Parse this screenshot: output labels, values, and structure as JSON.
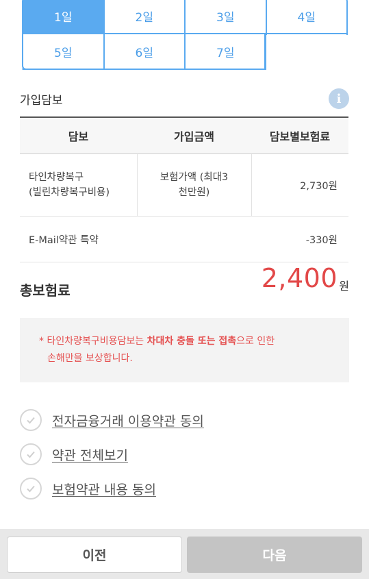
{
  "days": [
    {
      "label": "1일",
      "active": true
    },
    {
      "label": "2일",
      "active": false
    },
    {
      "label": "3일",
      "active": false
    },
    {
      "label": "4일",
      "active": false
    },
    {
      "label": "5일",
      "active": false
    },
    {
      "label": "6일",
      "active": false
    },
    {
      "label": "7일",
      "active": false
    }
  ],
  "coverage": {
    "title": "가입담보",
    "info_icon": "info-icon",
    "headers": {
      "col1": "담보",
      "col2": "가입금액",
      "col3": "담보별보험료"
    },
    "rows": [
      {
        "name_line1": "타인차량복구",
        "name_line2": "(빌린차량복구비용)",
        "amount_line1": "보험가액 (최대3",
        "amount_line2": "천만원)",
        "premium": "2,730원"
      },
      {
        "name_line1": "E-Mail약관 특약",
        "premium": "-330원"
      }
    ]
  },
  "total": {
    "label": "총보험료",
    "amount": "2,400",
    "unit": "원"
  },
  "notice": {
    "prefix": "* 타인차량복구비용담보는 ",
    "bold": "차대차 충돌 또는 접촉",
    "suffix": "으로 인한",
    "line2": "손해만을 보상합니다."
  },
  "agreements": [
    {
      "label": "전자금융거래 이용약관 동의",
      "icon": "check-icon"
    },
    {
      "label": "약관 전체보기",
      "icon": "check-icon"
    },
    {
      "label": "보험약관 내용 동의",
      "icon": "check-icon"
    }
  ],
  "buttons": {
    "prev": "이전",
    "next": "다음"
  },
  "colors": {
    "accent": "#5aaaf0",
    "highlight": "#e24848",
    "disabled": "#c4c4c4"
  }
}
